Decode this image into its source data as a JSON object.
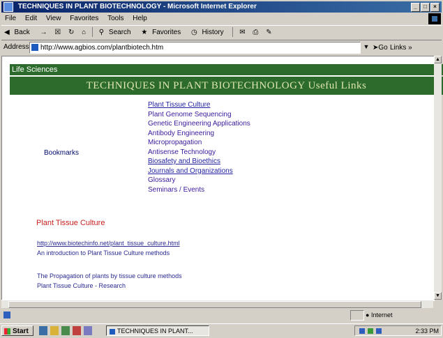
{
  "window": {
    "title": "TECHNIQUES IN PLANT BIOTECHNOLOGY - Microsoft Internet Explorer"
  },
  "menu": [
    "File",
    "Edit",
    "View",
    "Favorites",
    "Tools",
    "Help"
  ],
  "toolbar": {
    "back": "Back",
    "forward": "→",
    "search": "Search",
    "favorites": "Favorites",
    "history": "History"
  },
  "address": {
    "label": "Address",
    "value": "http://www.agbios.com/plantbiotech.htm",
    "go": "Go",
    "links": "Links"
  },
  "page": {
    "header_small": "Life Sciences",
    "header_title": "TECHNIQUES IN PLANT BIOTECHNOLOGY    Useful Links",
    "bookmarks_label": "Bookmarks",
    "links": [
      "Plant Tissue Culture",
      "Plant Genome Sequencing",
      "Genetic Engineering Applications",
      "Antibody Engineering",
      "Micropropagation",
      "Antisense Technology",
      "Biosafety and Bioethics",
      "Journals and Organizations",
      "Glossary",
      "Seminars / Events"
    ],
    "section_heading": "Plant Tissue Culture",
    "para1_line1": "http://www.biotechinfo.net/plant_tissue_culture.html",
    "para1_line2": "An introduction to Plant Tissue Culture methods",
    "para2_line1": "The Propagation of plants by tissue culture methods",
    "para2_line2": "Plant Tissue Culture - Research"
  },
  "status": {
    "zone": "Internet"
  },
  "taskbar": {
    "start": "Start",
    "task": "TECHNIQUES IN PLANT...",
    "clock": "2:33 PM"
  }
}
